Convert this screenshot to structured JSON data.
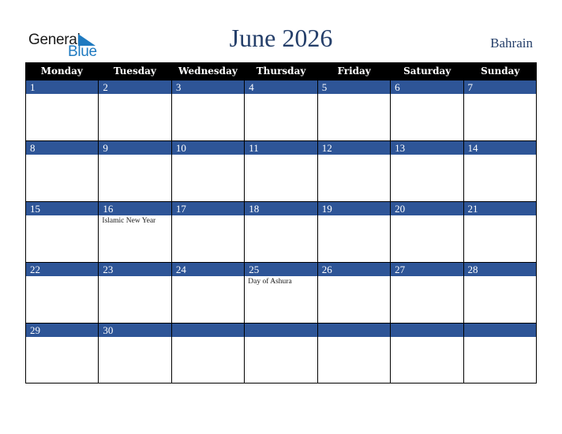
{
  "logo": {
    "line1": "General",
    "line2": "Blue",
    "accent_color": "#1f7ac0"
  },
  "title": "June 2026",
  "country": "Bahrain",
  "colors": {
    "header_bg": "#000000",
    "daybar_bg": "#2e5597",
    "title": "#253f6a"
  },
  "weekdays": [
    "Monday",
    "Tuesday",
    "Wednesday",
    "Thursday",
    "Friday",
    "Saturday",
    "Sunday"
  ],
  "weeks": [
    {
      "days": [
        "1",
        "2",
        "3",
        "4",
        "5",
        "6",
        "7"
      ],
      "events": [
        "",
        "",
        "",
        "",
        "",
        "",
        ""
      ]
    },
    {
      "days": [
        "8",
        "9",
        "10",
        "11",
        "12",
        "13",
        "14"
      ],
      "events": [
        "",
        "",
        "",
        "",
        "",
        "",
        ""
      ]
    },
    {
      "days": [
        "15",
        "16",
        "17",
        "18",
        "19",
        "20",
        "21"
      ],
      "events": [
        "",
        "Islamic New Year",
        "",
        "",
        "",
        "",
        ""
      ]
    },
    {
      "days": [
        "22",
        "23",
        "24",
        "25",
        "26",
        "27",
        "28"
      ],
      "events": [
        "",
        "",
        "",
        "Day of Ashura",
        "",
        "",
        ""
      ]
    },
    {
      "days": [
        "29",
        "30",
        "",
        "",
        "",
        "",
        ""
      ],
      "events": [
        "",
        "",
        "",
        "",
        "",
        "",
        ""
      ]
    }
  ]
}
